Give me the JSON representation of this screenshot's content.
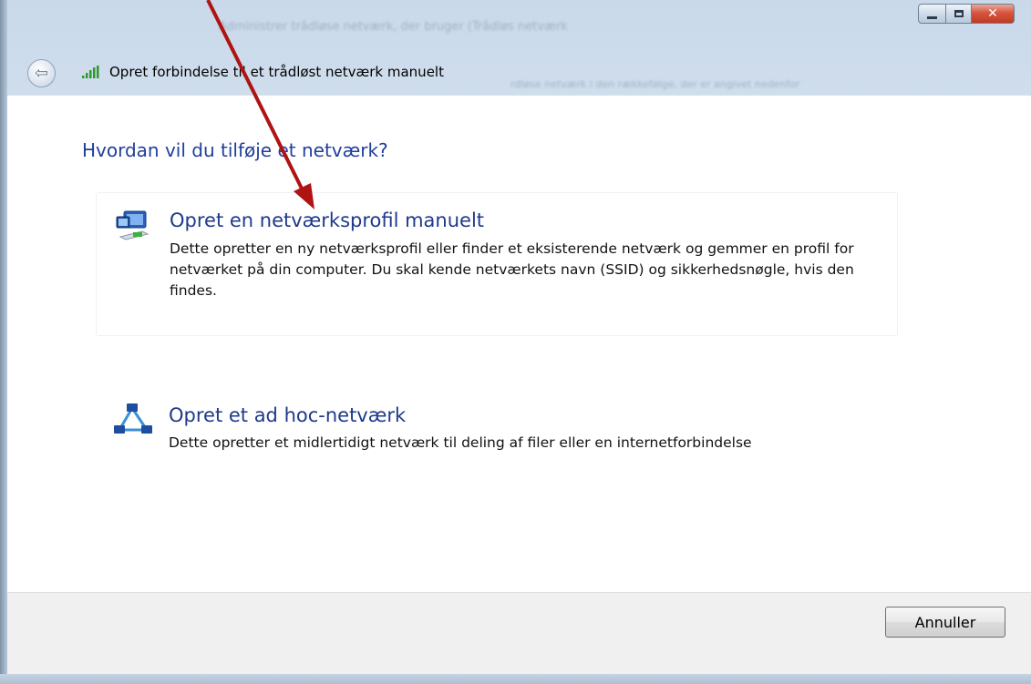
{
  "window": {
    "background_title": "Administrer trådløse netværk, der bruger (Trådløs netværk",
    "background_subtitle": "rdløse netværk i den rækkefølge, der er angivet nedenfor"
  },
  "nav": {
    "title": "Opret forbindelse til et trådløst netværk manuelt",
    "back_icon": "back-arrow-icon",
    "signal_icon": "wireless-signal-icon"
  },
  "main": {
    "heading": "Hvordan vil du tilføje et netværk?",
    "options": [
      {
        "icon": "network-profile-icon",
        "title": "Opret en netværksprofil manuelt",
        "description": "Dette opretter en ny netværksprofil eller finder et eksisterende netværk og gemmer en profil for netværket på din computer. Du skal kende netværkets navn (SSID) og sikkerhedsnøgle, hvis den findes."
      },
      {
        "icon": "ad-hoc-network-icon",
        "title": "Opret et ad hoc-netværk",
        "description": "Dette opretter et midlertidigt netværk til deling af filer eller en internetforbindelse"
      }
    ]
  },
  "footer": {
    "cancel_label": "Annuller"
  },
  "colors": {
    "heading": "#1f3f9a",
    "option_title": "#1e3a8a",
    "annotation_arrow": "#b01313",
    "close_button": "#c13a22"
  }
}
